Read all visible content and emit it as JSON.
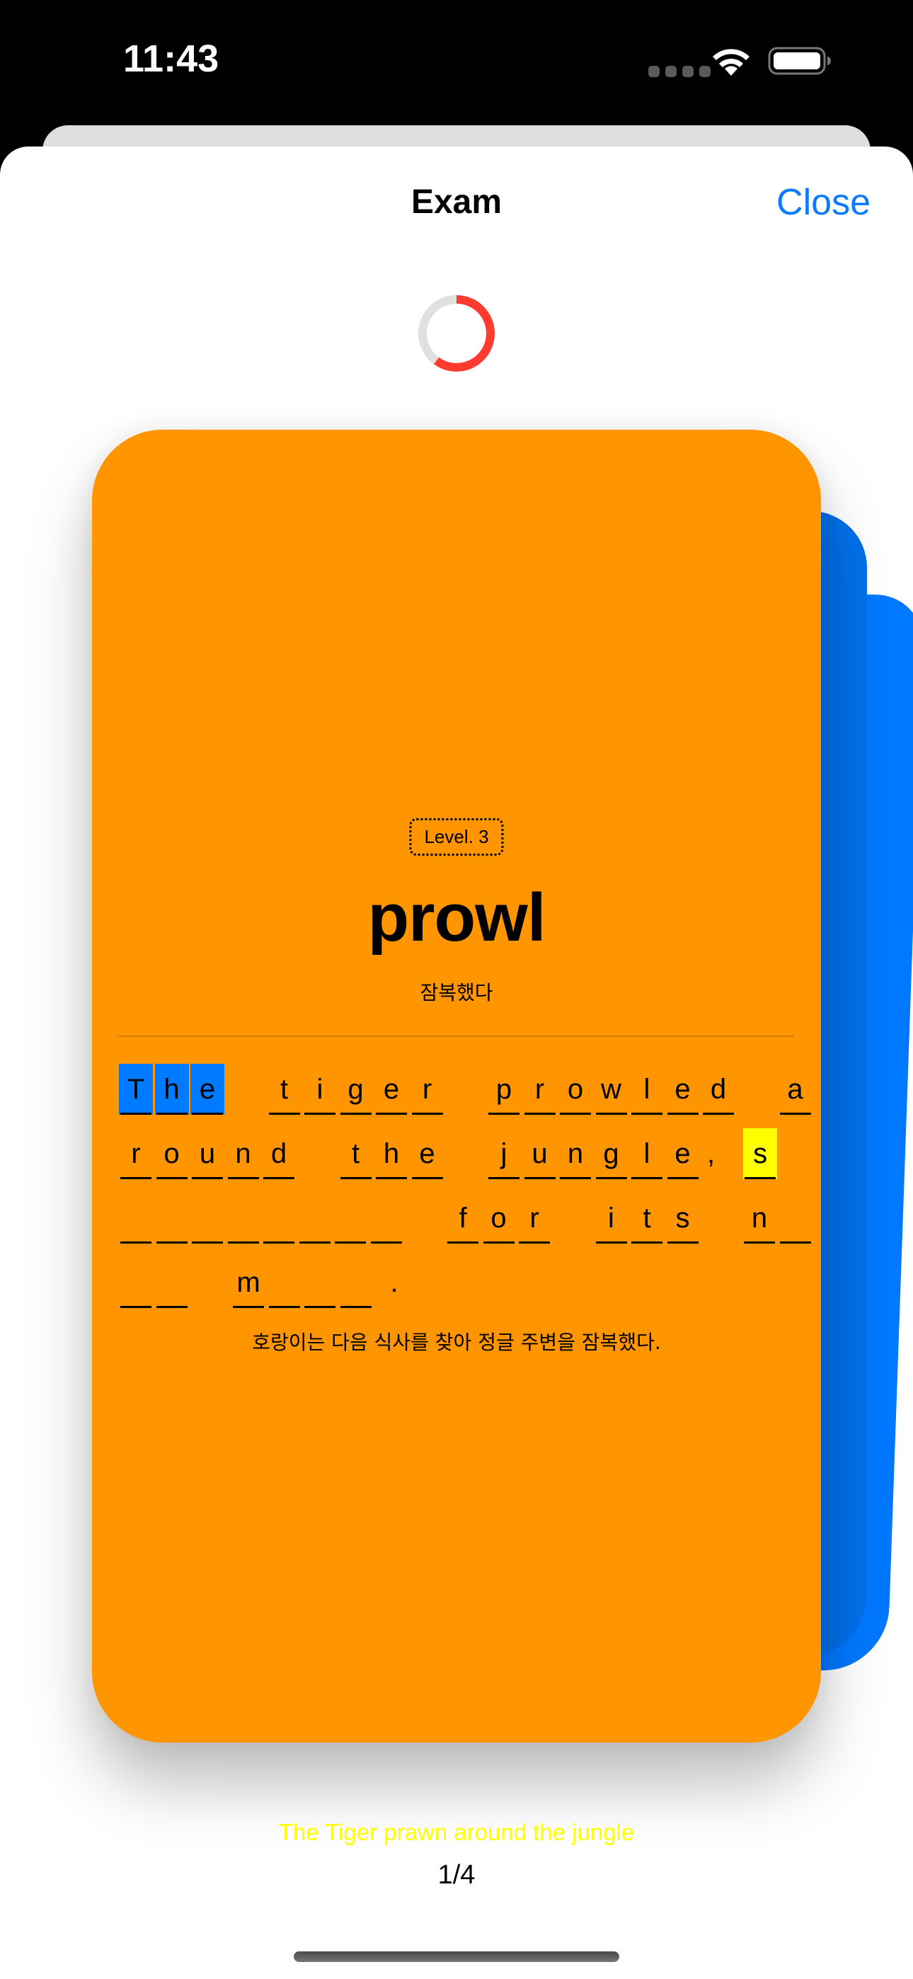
{
  "status_bar": {
    "time": "11:43",
    "icons": [
      "cellular-signal-icon",
      "wifi-icon",
      "battery-icon"
    ]
  },
  "nav": {
    "title": "Exam",
    "close_label": "Close"
  },
  "timer": {
    "progress": 0.6,
    "track_color": "#e0e0e0",
    "fill_color": "#ff3b30"
  },
  "card": {
    "background": "#ff9500",
    "level": "Level. 3",
    "word": "prowl",
    "meaning": "잠복했다",
    "puzzle_rows": [
      [
        {
          "slots": [
            {
              "ch": "T",
              "hl": "blue"
            },
            {
              "ch": "h",
              "hl": "blue"
            },
            {
              "ch": "e",
              "hl": "blue"
            }
          ]
        },
        {
          "slots": [
            {
              "ch": "t"
            },
            {
              "ch": "i"
            },
            {
              "ch": "g"
            },
            {
              "ch": "e"
            },
            {
              "ch": "r"
            }
          ]
        },
        {
          "slots": [
            {
              "ch": "p"
            },
            {
              "ch": "r"
            },
            {
              "ch": "o"
            },
            {
              "ch": "w"
            },
            {
              "ch": "l"
            },
            {
              "ch": "e"
            },
            {
              "ch": "d"
            }
          ]
        },
        {
          "slots": [
            {
              "ch": "a"
            }
          ]
        }
      ],
      [
        {
          "slots": [
            {
              "ch": "r"
            },
            {
              "ch": "o"
            },
            {
              "ch": "u"
            },
            {
              "ch": "n"
            },
            {
              "ch": "d"
            }
          ]
        },
        {
          "slots": [
            {
              "ch": "t"
            },
            {
              "ch": "h"
            },
            {
              "ch": "e"
            }
          ]
        },
        {
          "slots": [
            {
              "ch": "j"
            },
            {
              "ch": "u"
            },
            {
              "ch": "n"
            },
            {
              "ch": "g"
            },
            {
              "ch": "l"
            },
            {
              "ch": "e"
            }
          ],
          "punct": ","
        },
        {
          "slots": [
            {
              "ch": "s",
              "hl": "yellow"
            }
          ]
        }
      ],
      [
        {
          "slots": [
            {
              "ch": ""
            },
            {
              "ch": ""
            },
            {
              "ch": ""
            },
            {
              "ch": ""
            },
            {
              "ch": ""
            },
            {
              "ch": ""
            },
            {
              "ch": ""
            },
            {
              "ch": ""
            }
          ]
        },
        {
          "slots": [
            {
              "ch": "f"
            },
            {
              "ch": "o"
            },
            {
              "ch": "r"
            }
          ]
        },
        {
          "slots": [
            {
              "ch": "i"
            },
            {
              "ch": "t"
            },
            {
              "ch": "s"
            }
          ]
        },
        {
          "slots": [
            {
              "ch": "n"
            },
            {
              "ch": ""
            }
          ]
        }
      ],
      [
        {
          "slots": [
            {
              "ch": ""
            },
            {
              "ch": ""
            }
          ]
        },
        {
          "slots": [
            {
              "ch": "m"
            },
            {
              "ch": ""
            },
            {
              "ch": ""
            },
            {
              "ch": ""
            }
          ],
          "punct": "."
        }
      ]
    ],
    "translation": "호랑이는 다음 식사를 찾아 정글 주변을 잠복했다."
  },
  "footer": {
    "hint": "The Tiger prawn around the jungle",
    "page_counter": "1/4"
  },
  "colors": {
    "accent": "#0a7aff",
    "card_orange": "#ff9500",
    "stack_blue": "#0073f0",
    "highlight_blue": "#007aff",
    "highlight_yellow": "#ffff00",
    "hint_yellow": "#ffff00"
  }
}
